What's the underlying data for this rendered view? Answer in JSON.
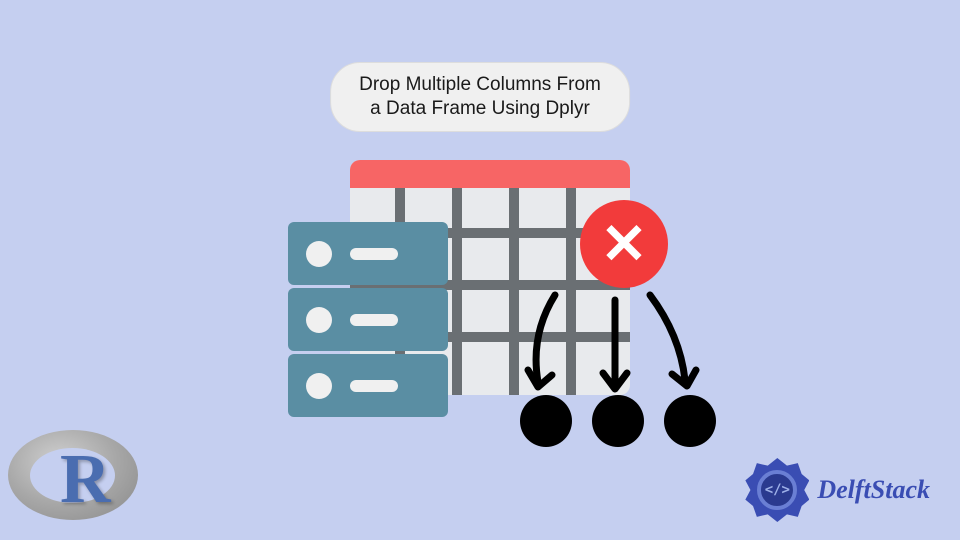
{
  "title": {
    "line1": "Drop Multiple Columns From",
    "line2": "a Data Frame Using Dplyr"
  },
  "logos": {
    "r": "R",
    "delft": "DelftStack",
    "delft_code": "</>"
  },
  "icons": {
    "delete": "✕"
  }
}
